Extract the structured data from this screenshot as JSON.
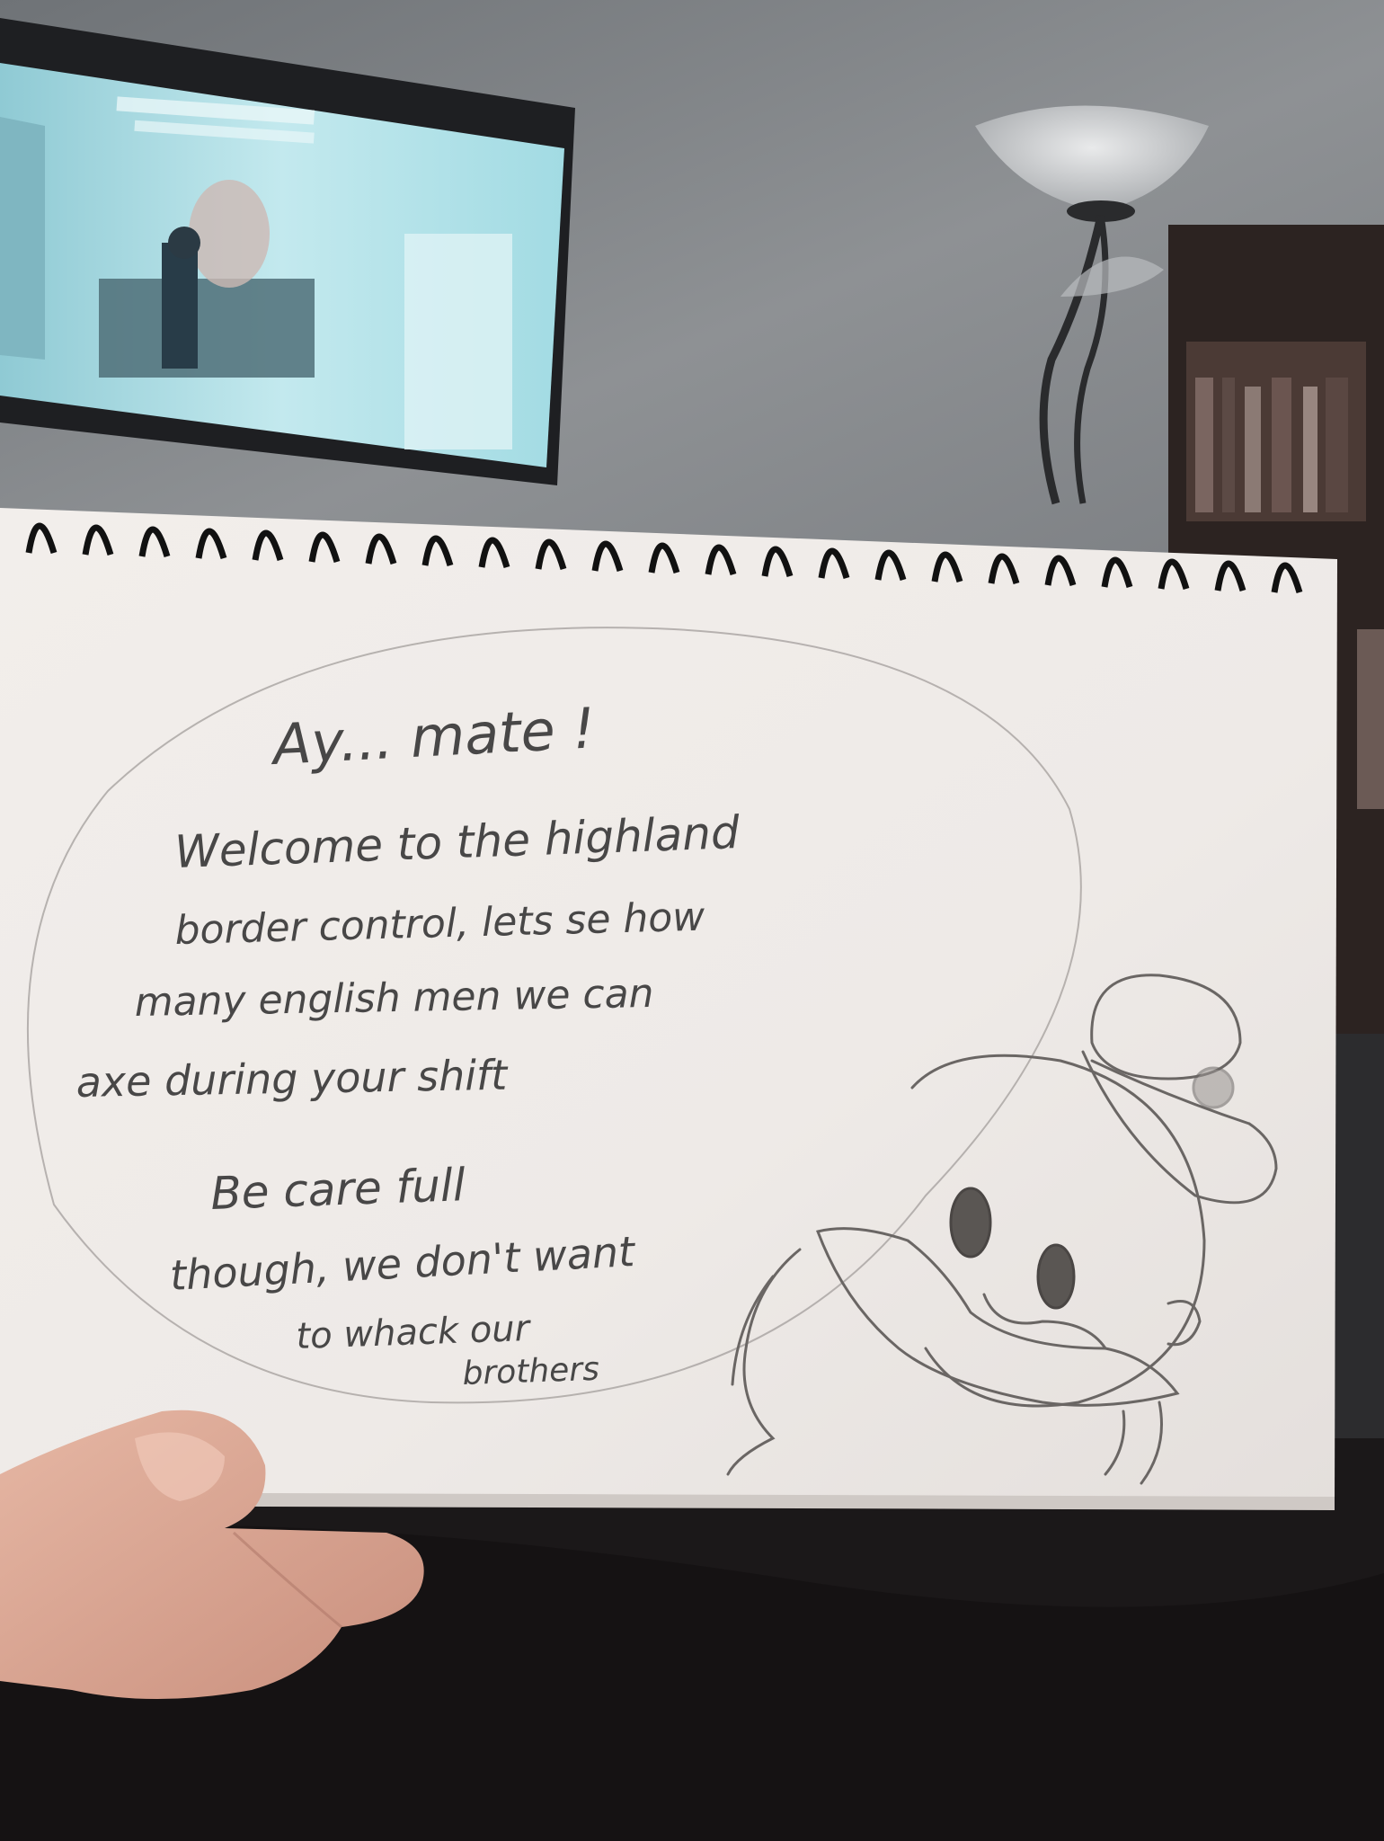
{
  "sketchbook": {
    "speech_bubble": {
      "line1": "Ay... mate !",
      "line2": "Welcome to the highland",
      "line3": "border control, lets se how",
      "line4": "many english men we can",
      "line5": "axe during your shift",
      "line6": "Be care full",
      "line7": "though, we don't want",
      "line8": "to whack our",
      "line9": "brothers"
    },
    "drawing": "pencil sketch of a duck wearing a sailor cap with a mustache and sideburns"
  },
  "background": {
    "tv_scene": "office interior with figures",
    "lamp": "floor lamp with bowl shade"
  },
  "colors": {
    "wall": "#8a8c90",
    "paper": "#efebe8",
    "pencil": "#4a4a4a",
    "tv_screen": "#a9dfe6",
    "blanket": "#1a1718",
    "skin": "#d9a896"
  }
}
